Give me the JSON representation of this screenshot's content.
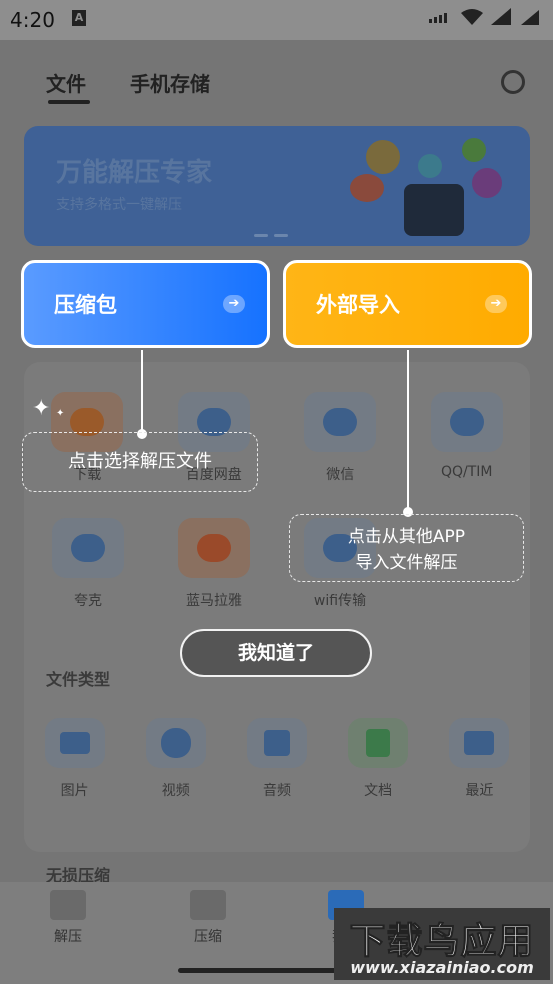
{
  "status_bar": {
    "time": "4:20",
    "notification_glyph": "A"
  },
  "background": {
    "tabs": [
      "文件",
      "手机存储"
    ],
    "banner": {
      "title": "万能解压专家",
      "subtitle": "支持多格式一键解压"
    },
    "sources": [
      {
        "label": "下载",
        "icon": "download-icon"
      },
      {
        "label": "百度网盘",
        "icon": "cloud-icon"
      },
      {
        "label": "微信",
        "icon": "wechat-icon"
      },
      {
        "label": "QQ/TIM",
        "icon": "qq-icon"
      },
      {
        "label": "夸克",
        "icon": "quark-icon"
      },
      {
        "label": "蓝马拉雅",
        "icon": "ximalaya-icon"
      },
      {
        "label": "wifi传输",
        "icon": "wifi-icon"
      }
    ],
    "file_types_title": "文件类型",
    "file_types": [
      {
        "label": "图片",
        "icon": "image-icon"
      },
      {
        "label": "视频",
        "icon": "video-icon"
      },
      {
        "label": "音频",
        "icon": "audio-icon"
      },
      {
        "label": "文档",
        "icon": "document-icon"
      },
      {
        "label": "最近",
        "icon": "recent-icon"
      }
    ],
    "lossless_title": "无损压缩",
    "bottom_nav": [
      "解压",
      "压缩",
      "我的"
    ]
  },
  "guide": {
    "compress_button": "压缩包",
    "import_button": "外部导入",
    "tip_select": "点击选择解压文件",
    "tip_import_line1": "点击从其他APP",
    "tip_import_line2": "导入文件解压",
    "got_it": "我知道了",
    "arrow_glyph": "➔"
  },
  "watermark": {
    "brand": "下载鸟应用",
    "url": "www.xiazainiao.com"
  },
  "colors": {
    "compress_start": "#5a9bff",
    "compress_end": "#1672ff",
    "import": "#ffb516",
    "overlay": "#6b6b6b"
  }
}
